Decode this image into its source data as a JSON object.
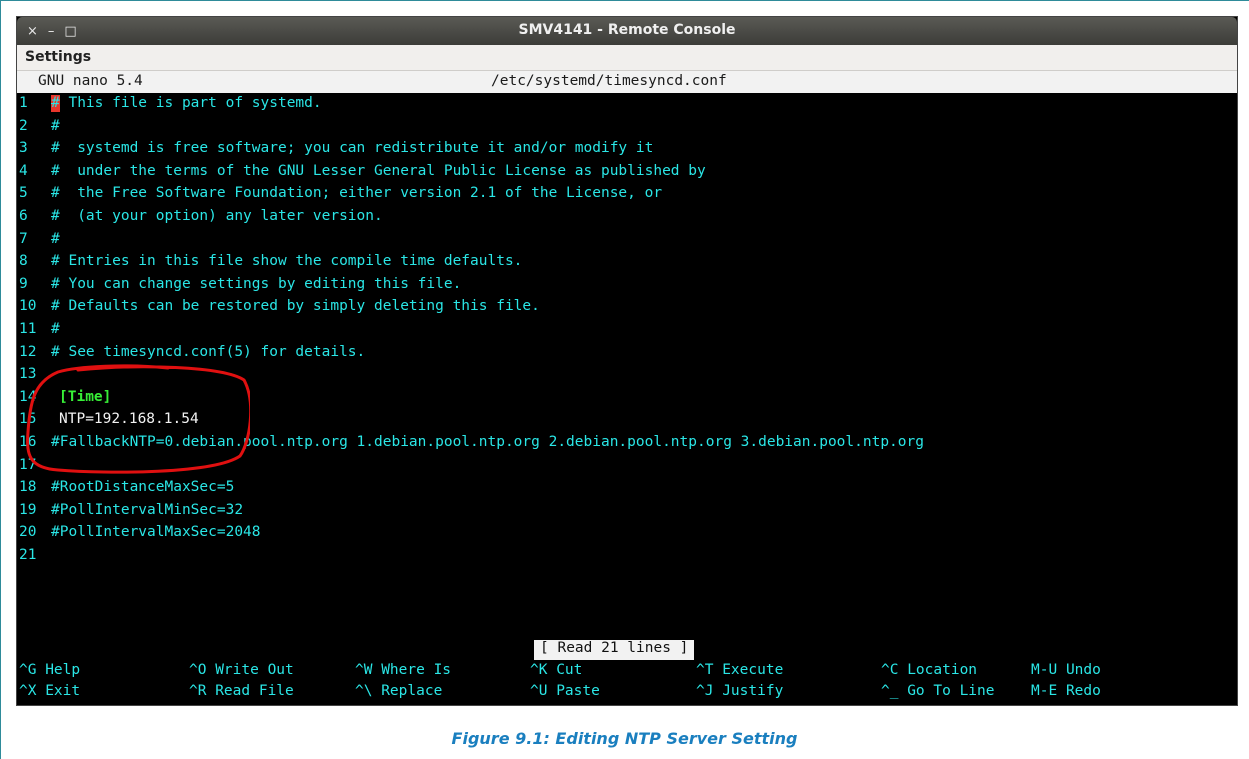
{
  "window": {
    "title": "SMV4141 - Remote Console",
    "controls": [
      "×",
      "–",
      "□"
    ]
  },
  "menubar": {
    "settings": "Settings"
  },
  "nano": {
    "version": "GNU nano 5.4",
    "filename": "/etc/systemd/timesyncd.conf",
    "lines": [
      {
        "no": "1",
        "text": "# This file is part of systemd.",
        "style": "comment",
        "cursor": true
      },
      {
        "no": "2",
        "text": "#",
        "style": "comment"
      },
      {
        "no": "3",
        "text": "#  systemd is free software; you can redistribute it and/or modify it",
        "style": "comment"
      },
      {
        "no": "4",
        "text": "#  under the terms of the GNU Lesser General Public License as published by",
        "style": "comment"
      },
      {
        "no": "5",
        "text": "#  the Free Software Foundation; either version 2.1 of the License, or",
        "style": "comment"
      },
      {
        "no": "6",
        "text": "#  (at your option) any later version.",
        "style": "comment"
      },
      {
        "no": "7",
        "text": "#",
        "style": "comment"
      },
      {
        "no": "8",
        "text": "# Entries in this file show the compile time defaults.",
        "style": "comment"
      },
      {
        "no": "9",
        "text": "# You can change settings by editing this file.",
        "style": "comment"
      },
      {
        "no": "10",
        "text": "# Defaults can be restored by simply deleting this file.",
        "style": "comment"
      },
      {
        "no": "11",
        "text": "#",
        "style": "comment"
      },
      {
        "no": "12",
        "text": "# See timesyncd.conf(5) for details.",
        "style": "comment"
      },
      {
        "no": "13",
        "text": "",
        "style": "comment"
      },
      {
        "no": "14",
        "text": "[Time]",
        "style": "section"
      },
      {
        "no": "15",
        "text": "NTP=192.168.1.54",
        "style": "plain"
      },
      {
        "no": "16",
        "text": "#FallbackNTP=0.debian.pool.ntp.org 1.debian.pool.ntp.org 2.debian.pool.ntp.org 3.debian.pool.ntp.org",
        "style": "comment"
      },
      {
        "no": "17",
        "text": "",
        "style": "comment"
      },
      {
        "no": "18",
        "text": "#RootDistanceMaxSec=5",
        "style": "comment"
      },
      {
        "no": "19",
        "text": "#PollIntervalMinSec=32",
        "style": "comment"
      },
      {
        "no": "20",
        "text": "#PollIntervalMaxSec=2048",
        "style": "comment"
      },
      {
        "no": "21",
        "text": "",
        "style": "comment"
      }
    ],
    "status": "[ Read 21 lines ]",
    "shortcuts": [
      {
        "key": "^G",
        "label": "Help"
      },
      {
        "key": "^O",
        "label": "Write Out"
      },
      {
        "key": "^W",
        "label": "Where Is"
      },
      {
        "key": "^K",
        "label": "Cut"
      },
      {
        "key": "^T",
        "label": "Execute"
      },
      {
        "key": "^C",
        "label": "Location"
      },
      {
        "key": "M-U",
        "label": "Undo"
      },
      {
        "key": "^X",
        "label": "Exit"
      },
      {
        "key": "^R",
        "label": "Read File"
      },
      {
        "key": "^\\",
        "label": "Replace"
      },
      {
        "key": "^U",
        "label": "Paste"
      },
      {
        "key": "^J",
        "label": "Justify"
      },
      {
        "key": "^_",
        "label": "Go To Line"
      },
      {
        "key": "M-E",
        "label": "Redo"
      }
    ]
  },
  "caption": "Figure 9.1: Editing NTP Server Setting",
  "colors": {
    "terminal_text": "#2ae6e6",
    "section_text": "#37ef37",
    "annotation": "#e01010",
    "caption": "#1a7fbf"
  }
}
